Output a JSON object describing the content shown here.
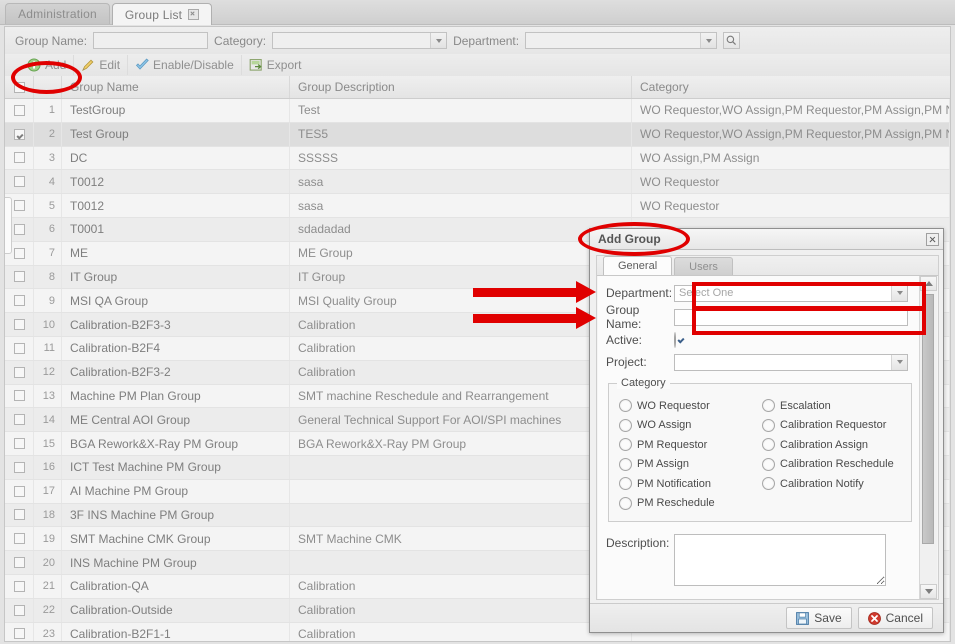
{
  "tabs": [
    {
      "label": "Administration",
      "active": false,
      "closable": false
    },
    {
      "label": "Group List",
      "active": true,
      "closable": true
    }
  ],
  "search": {
    "group_name_label": "Group Name:",
    "group_name_value": "",
    "category_label": "Category:",
    "category_value": "",
    "department_label": "Department:",
    "department_value": "",
    "search_icon": "magnifier-icon"
  },
  "toolbar": [
    {
      "label": "Add",
      "icon": "plus-circle-icon"
    },
    {
      "label": "Edit",
      "icon": "pencil-icon"
    },
    {
      "label": "Enable/Disable",
      "icon": "check-icon"
    },
    {
      "label": "Export",
      "icon": "export-icon"
    }
  ],
  "grid": {
    "columns": [
      "",
      "",
      "Group Name",
      "Group Description",
      "Category"
    ],
    "rows": [
      {
        "n": "1",
        "checked": false,
        "name": "TestGroup",
        "desc": "Test",
        "cat": "WO Requestor,WO Assign,PM Requestor,PM Assign,PM Notification,PM"
      },
      {
        "n": "2",
        "checked": true,
        "name": "Test Group",
        "desc": "TES5",
        "cat": "WO Requestor,WO Assign,PM Requestor,PM Assign,PM Notification,PM"
      },
      {
        "n": "3",
        "checked": false,
        "name": "DC",
        "desc": "SSSSS",
        "cat": "WO Assign,PM Assign"
      },
      {
        "n": "4",
        "checked": false,
        "name": "T0012",
        "desc": "sasa",
        "cat": "WO Requestor"
      },
      {
        "n": "5",
        "checked": false,
        "name": "T0012",
        "desc": "sasa",
        "cat": "WO Requestor"
      },
      {
        "n": "6",
        "checked": false,
        "name": "T0001",
        "desc": "sdadadad",
        "cat": ""
      },
      {
        "n": "7",
        "checked": false,
        "name": "ME",
        "desc": "ME Group",
        "cat": ""
      },
      {
        "n": "8",
        "checked": false,
        "name": "IT Group",
        "desc": "IT Group",
        "cat": ""
      },
      {
        "n": "9",
        "checked": false,
        "name": "MSI QA Group",
        "desc": "MSI Quality Group",
        "cat": ""
      },
      {
        "n": "10",
        "checked": false,
        "name": "Calibration-B2F3-3",
        "desc": "Calibration",
        "cat": ""
      },
      {
        "n": "11",
        "checked": false,
        "name": "Calibration-B2F4",
        "desc": "Calibration",
        "cat": ""
      },
      {
        "n": "12",
        "checked": false,
        "name": "Calibration-B2F3-2",
        "desc": "Calibration",
        "cat": ""
      },
      {
        "n": "13",
        "checked": false,
        "name": "Machine PM Plan Group",
        "desc": "SMT machine Reschedule and Rearrangement",
        "cat": ""
      },
      {
        "n": "14",
        "checked": false,
        "name": "ME Central AOI Group",
        "desc": "General Technical Support For AOI/SPI machines",
        "cat": ""
      },
      {
        "n": "15",
        "checked": false,
        "name": "BGA Rework&X-Ray PM Group",
        "desc": "BGA Rework&X-Ray PM Group",
        "cat": ""
      },
      {
        "n": "16",
        "checked": false,
        "name": "ICT Test Machine PM Group",
        "desc": "",
        "cat": ""
      },
      {
        "n": "17",
        "checked": false,
        "name": "AI Machine PM Group",
        "desc": "",
        "cat": ""
      },
      {
        "n": "18",
        "checked": false,
        "name": "3F INS Machine PM Group",
        "desc": "",
        "cat": ""
      },
      {
        "n": "19",
        "checked": false,
        "name": "SMT Machine CMK Group",
        "desc": "SMT Machine CMK",
        "cat": ""
      },
      {
        "n": "20",
        "checked": false,
        "name": "INS Machine PM Group",
        "desc": "",
        "cat": ""
      },
      {
        "n": "21",
        "checked": false,
        "name": "Calibration-QA",
        "desc": "Calibration",
        "cat": ""
      },
      {
        "n": "22",
        "checked": false,
        "name": "Calibration-Outside",
        "desc": "Calibration",
        "cat": ""
      },
      {
        "n": "23",
        "checked": false,
        "name": "Calibration-B2F1-1",
        "desc": "Calibration",
        "cat": ""
      }
    ]
  },
  "dialog": {
    "title": "Add Group",
    "close_icon": "close-icon",
    "tabs": [
      {
        "label": "General",
        "active": true
      },
      {
        "label": "Users",
        "active": false
      }
    ],
    "fields": {
      "department_label": "Department:",
      "department_value": "Select One",
      "group_name_label": "Group Name:",
      "group_name_value": "",
      "active_label": "Active:",
      "active_checked": true,
      "project_label": "Project:",
      "project_value": "",
      "description_label": "Description:",
      "description_value": ""
    },
    "category": {
      "legend": "Category",
      "left": [
        "WO Requestor",
        "WO Assign",
        "PM Requestor",
        "PM Assign",
        "PM Notification",
        "PM Reschedule"
      ],
      "right": [
        "Escalation",
        "Calibration Requestor",
        "Calibration Assign",
        "Calibration Reschedule",
        "Calibration Notify"
      ]
    },
    "buttons": [
      {
        "label": "Save",
        "icon": "floppy-save-icon"
      },
      {
        "label": "Cancel",
        "icon": "cancel-circle-icon"
      }
    ]
  },
  "annotations": {
    "color": "#e00000",
    "shapes": [
      "ellipse-around-add-button",
      "ellipse-around-add-group-title",
      "arrow-to-department-field",
      "arrow-to-group-name-field",
      "rect-around-department-select",
      "rect-around-group-name-input"
    ]
  }
}
